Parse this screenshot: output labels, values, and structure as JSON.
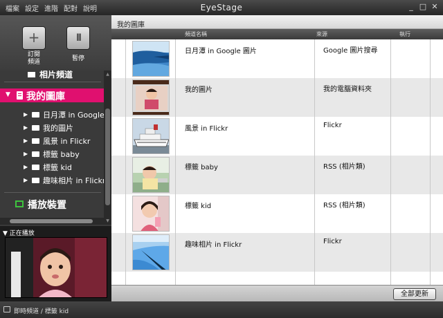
{
  "window": {
    "title": "EyeStage",
    "menu": [
      "檔案",
      "設定",
      "進階",
      "配對",
      "說明"
    ]
  },
  "toolbar": {
    "subscribe_label_line1": "訂閱",
    "subscribe_label_line2": "頻道",
    "pause_label": "暫停"
  },
  "sidebar": {
    "partial_item": "相片頻道",
    "library_label": "我的圖庫",
    "items": [
      {
        "label": "日月潭 in Google"
      },
      {
        "label": "我的圖片"
      },
      {
        "label": "風景 in Flickr"
      },
      {
        "label": "標籤 baby"
      },
      {
        "label": "標籤 kid"
      },
      {
        "label": "趣味相片 in Flickr"
      }
    ],
    "devices_label": "播放裝置"
  },
  "now_playing": {
    "title": "正在播放"
  },
  "main": {
    "title": "我的圖庫",
    "columns": {
      "name": "頻道名稱",
      "source": "來源",
      "run": "執行"
    },
    "rows": [
      {
        "name": "日月潭 in Google 圖片",
        "source": "Google 圖片搜尋"
      },
      {
        "name": "我的圖片",
        "source": "我的電腦資料夾"
      },
      {
        "name": "風景 in Flickr",
        "source": "Flickr"
      },
      {
        "name": "標籤 baby",
        "source": "RSS (相片類)"
      },
      {
        "name": "標籤 kid",
        "source": "RSS (相片類)"
      },
      {
        "name": "趣味相片 in Flickr",
        "source": "Flickr"
      }
    ],
    "update_all_label": "全部更新"
  },
  "status": {
    "text": "即時頻道 / 標籤 kid"
  },
  "colors": {
    "accent": "#e0106f",
    "devices_icon": "#3ec33e"
  }
}
